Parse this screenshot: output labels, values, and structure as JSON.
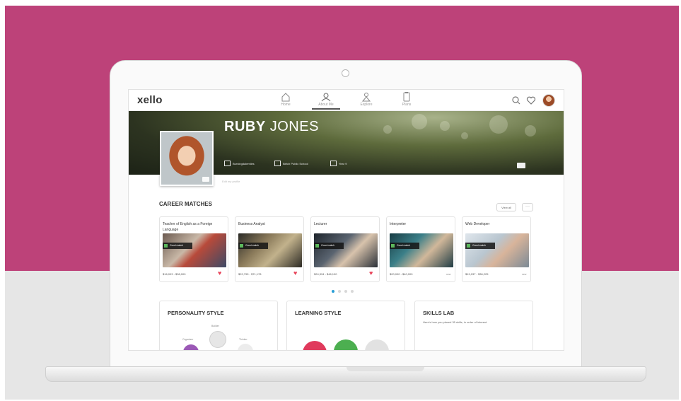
{
  "app": {
    "logo": "xello"
  },
  "nav": [
    {
      "label": "Home",
      "icon": "home-icon"
    },
    {
      "label": "About Me",
      "icon": "person-icon",
      "active": true
    },
    {
      "label": "Explore",
      "icon": "explore-icon"
    },
    {
      "label": "Plans",
      "icon": "clipboard-icon"
    }
  ],
  "header_icons": [
    "search-icon",
    "heart-icon",
    "avatar"
  ],
  "profile": {
    "first_name": "RUBY",
    "last_name": "JONES",
    "meta": [
      "Burningdalemiles",
      "Birtch Public School",
      "Year 9"
    ],
    "edit_text": "Edit my profile"
  },
  "career_matches": {
    "title": "CAREER MATCHES",
    "view_all": "View all",
    "more": "···",
    "cards": [
      {
        "title": "Teacher of English as a Foreign Language",
        "fit": "Good match",
        "salary": "$16,003 - $38,000",
        "favorite": true
      },
      {
        "title": "Business Analyst",
        "fit": "Good match",
        "salary": "$22,795 - $71,178",
        "favorite": true
      },
      {
        "title": "Lecturer",
        "fit": "Good match",
        "salary": "$24,394 - $46,100",
        "favorite": true
      },
      {
        "title": "Interpreter",
        "fit": "Good match",
        "salary": "$20,000 - $40,000",
        "favorite": false,
        "tag": "new"
      },
      {
        "title": "Web Developer",
        "fit": "Good match",
        "salary": "$19,037 - $36,225",
        "favorite": false,
        "tag": "new"
      }
    ],
    "pager": {
      "pages": 4,
      "current": 1
    }
  },
  "sections": {
    "personality": {
      "title": "PERSONALITY STYLE",
      "labels": [
        "Organiser",
        "Builder",
        "Thinker"
      ]
    },
    "learning": {
      "title": "LEARNING STYLE"
    },
    "skills": {
      "title": "SKILLS LAB",
      "subtitle": "Here's how you placed 35 skills, in order of interest."
    }
  },
  "colors": {
    "brand_pink": "#bd4279",
    "heart": "#e8445a",
    "active_dot": "#2a9fd6",
    "purple": "#9b59b6",
    "red": "#e03a5c",
    "green": "#4caf50"
  }
}
